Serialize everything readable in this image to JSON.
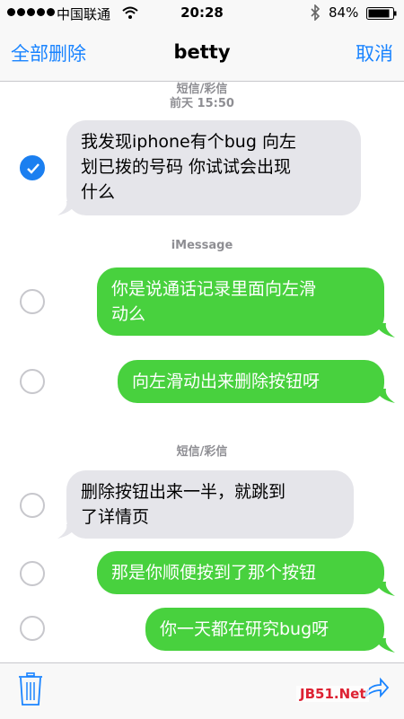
{
  "status_bar": {
    "carrier": "中国联通",
    "time": "20:28",
    "battery": "84%"
  },
  "nav": {
    "left": "全部删除",
    "title": "betty",
    "right": "取消"
  },
  "meta": {
    "top_type": "短信/彩信",
    "top_time": "前天 15:50",
    "imessage": "iMessage",
    "mid_type": "短信/彩信"
  },
  "messages": [
    {
      "dir": "in",
      "line1": "我发现iphone有个bug 向左",
      "line2": "划已拨的号码 你试试会出现",
      "line3": "什么",
      "selected": true
    },
    {
      "dir": "out",
      "line1": "你是说通话记录里面向左滑",
      "line2": "动么",
      "selected": false
    },
    {
      "dir": "out",
      "line1": "向左滑动出来删除按钮呀",
      "selected": false
    },
    {
      "dir": "in",
      "line1": "删除按钮出来一半，就跳到",
      "line2": "了详情页",
      "selected": false
    },
    {
      "dir": "out",
      "line1": "那是你顺便按到了那个按钮",
      "selected": false
    },
    {
      "dir": "out",
      "line1": "你一天都在研究bug呀",
      "selected": false
    }
  ],
  "toolbar": {
    "watermark": "JB51.Net",
    "delete_icon": "trash-icon",
    "share_icon": "share-icon"
  },
  "colors": {
    "accent": "#1a84ff",
    "incoming": "#e5e5ea",
    "outgoing": "#48d13e"
  }
}
